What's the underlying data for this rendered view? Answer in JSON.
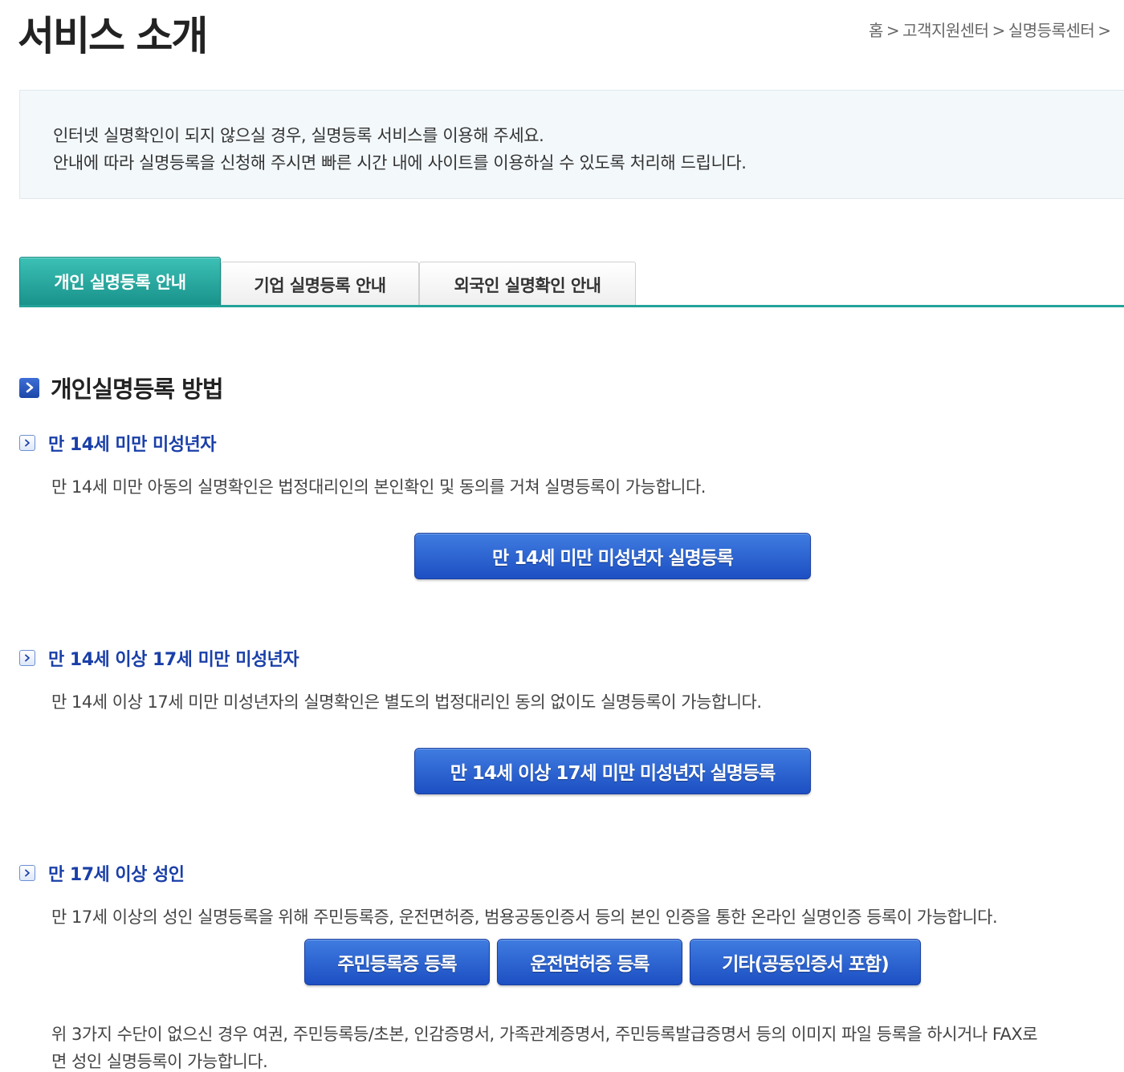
{
  "page": {
    "title": "서비스 소개"
  },
  "breadcrumb": {
    "items": [
      "홈",
      "고객지원센터",
      "실명등록센터"
    ],
    "separator": ">"
  },
  "intro": {
    "line1": "인터넷 실명확인이 되지 않으실 경우, 실명등록 서비스를 이용해 주세요.",
    "line2": "안내에 따라 실명등록을 신청해 주시면 빠른 시간 내에 사이트를 이용하실 수 있도록 처리해 드립니다."
  },
  "tabs": [
    {
      "label": "개인 실명등록 안내",
      "active": true
    },
    {
      "label": "기업 실명등록 안내",
      "active": false
    },
    {
      "label": "외국인 실명확인 안내",
      "active": false
    }
  ],
  "section": {
    "heading": "개인실명등록 방법"
  },
  "groups": {
    "under14": {
      "title": "만 14세 미만 미성년자",
      "description": "만 14세 미만 아동의 실명확인은 법정대리인의 본인확인 및 동의를 거쳐 실명등록이 가능합니다.",
      "button": "만 14세 미만 미성년자 실명등록"
    },
    "age14to17": {
      "title": "만 14세 이상 17세 미만 미성년자",
      "description": "만 14세 이상 17세 미만 미성년자의 실명확인은 별도의 법정대리인 동의 없이도 실명등록이 가능합니다.",
      "button": "만 14세 이상 17세 미만 미성년자 실명등록"
    },
    "adult": {
      "title": "만 17세 이상 성인",
      "description": "만 17세 이상의 성인 실명등록을 위해 주민등록증, 운전면허증, 범용공동인증서 등의 본인 인증을 통한 온라인 실명인증 등록이 가능합니다.",
      "buttons": [
        "주민등록증 등록",
        "운전면허증 등록",
        "기타(공동인증서 포함)"
      ]
    }
  },
  "footnote": {
    "line1": "위 3가지 수단이 없으신 경우 여권, 주민등록등/초본, 인감증명서, 가족관계증명서, 주민등록발급증명서 등의 이미지 파일 등록을 하시거나 FAX로",
    "line2": "면 성인 실명등록이 가능합니다."
  },
  "icons": {
    "heading": "chevron-right-icon",
    "sub": "chevron-right-icon"
  },
  "colors": {
    "tab_active": "#1fa69c",
    "button": "#2a5fd0",
    "sub_heading": "#1a3fa8",
    "intro_bg": "#f3f8fb"
  }
}
